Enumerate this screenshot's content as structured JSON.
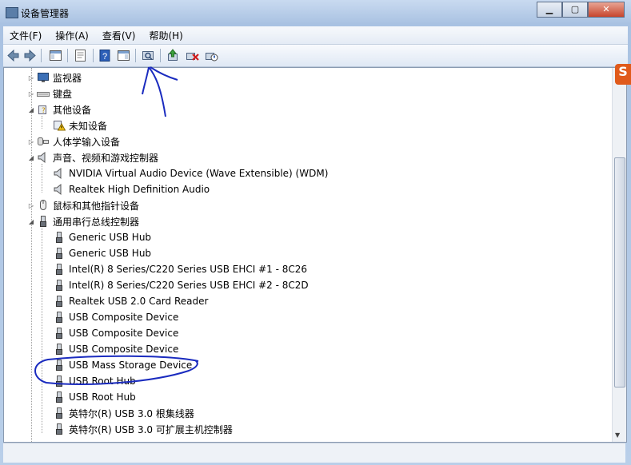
{
  "window": {
    "title": "设备管理器"
  },
  "window_buttons": {
    "minimize": "▁",
    "maximize": "▢",
    "close": "✕"
  },
  "menu": [
    "文件(F)",
    "操作(A)",
    "查看(V)",
    "帮助(H)"
  ],
  "toolbar_icons": [
    "back-icon",
    "forward-icon",
    "show-hide-tree-icon",
    "properties-icon",
    "help-icon",
    "action-pane-icon",
    "scan-hardware-icon",
    "update-driver-icon",
    "uninstall-icon",
    "disable-icon"
  ],
  "tree": [
    {
      "label": "监视器",
      "icon": "monitor-icon",
      "level": 0,
      "expander": "▷"
    },
    {
      "label": "键盘",
      "icon": "keyboard-icon",
      "level": 0,
      "expander": "▷"
    },
    {
      "label": "其他设备",
      "icon": "other-devices-icon",
      "level": 0,
      "expander": "◢"
    },
    {
      "label": "未知设备",
      "icon": "unknown-device-warning-icon",
      "level": 1,
      "expander": ""
    },
    {
      "label": "人体学输入设备",
      "icon": "hid-icon",
      "level": 0,
      "expander": "▷"
    },
    {
      "label": "声音、视频和游戏控制器",
      "icon": "speaker-icon",
      "level": 0,
      "expander": "◢"
    },
    {
      "label": "NVIDIA Virtual Audio Device (Wave Extensible) (WDM)",
      "icon": "speaker-icon",
      "level": 1,
      "expander": ""
    },
    {
      "label": "Realtek High Definition Audio",
      "icon": "speaker-icon",
      "level": 1,
      "expander": ""
    },
    {
      "label": "鼠标和其他指针设备",
      "icon": "mouse-icon",
      "level": 0,
      "expander": "▷"
    },
    {
      "label": "通用串行总线控制器",
      "icon": "usb-icon",
      "level": 0,
      "expander": "◢"
    },
    {
      "label": "Generic USB Hub",
      "icon": "usb-icon",
      "level": 1,
      "expander": ""
    },
    {
      "label": "Generic USB Hub",
      "icon": "usb-icon",
      "level": 1,
      "expander": ""
    },
    {
      "label": "Intel(R) 8 Series/C220 Series USB EHCI #1 - 8C26",
      "icon": "usb-icon",
      "level": 1,
      "expander": ""
    },
    {
      "label": "Intel(R) 8 Series/C220 Series USB EHCI #2 - 8C2D",
      "icon": "usb-icon",
      "level": 1,
      "expander": ""
    },
    {
      "label": "Realtek USB 2.0 Card Reader",
      "icon": "usb-icon",
      "level": 1,
      "expander": ""
    },
    {
      "label": "USB Composite Device",
      "icon": "usb-icon",
      "level": 1,
      "expander": ""
    },
    {
      "label": "USB Composite Device",
      "icon": "usb-icon",
      "level": 1,
      "expander": ""
    },
    {
      "label": "USB Composite Device",
      "icon": "usb-icon",
      "level": 1,
      "expander": ""
    },
    {
      "label": "USB Mass Storage Device",
      "icon": "usb-icon",
      "level": 1,
      "expander": ""
    },
    {
      "label": "USB Root Hub",
      "icon": "usb-icon",
      "level": 1,
      "expander": ""
    },
    {
      "label": "USB Root Hub",
      "icon": "usb-icon",
      "level": 1,
      "expander": ""
    },
    {
      "label": "英特尔(R) USB 3.0 根集线器",
      "icon": "usb-icon",
      "level": 1,
      "expander": ""
    },
    {
      "label": "英特尔(R) USB 3.0 可扩展主机控制器",
      "icon": "usb-icon",
      "level": 1,
      "expander": ""
    }
  ],
  "annotations": {
    "color": "#1a2bbf"
  },
  "overlay": {
    "sogou_badge": "S"
  }
}
